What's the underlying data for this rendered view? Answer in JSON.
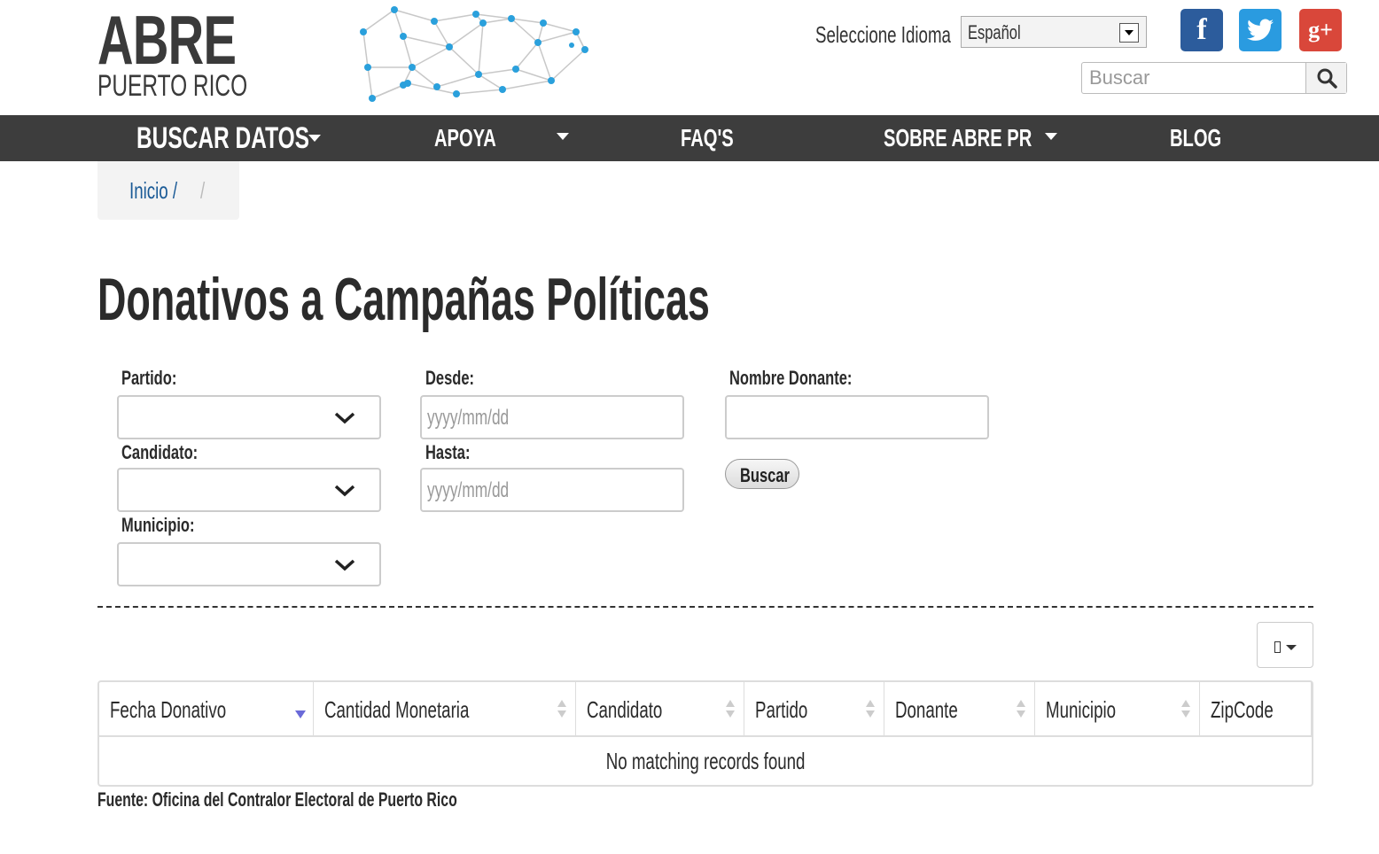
{
  "logo": {
    "line1": "ABRE",
    "line2": "PUERTO RICO",
    "network_color": "#2aa0dc"
  },
  "language": {
    "label": "Seleccione Idioma",
    "selected": "Español"
  },
  "social": {
    "facebook": "f",
    "google_plus": "g+",
    "facebook_color": "#2c5c9c",
    "twitter_color": "#2a9be0",
    "google_color": "#d9473a"
  },
  "search": {
    "placeholder": "Buscar"
  },
  "nav": {
    "items": [
      {
        "label": "BUSCAR DATOS"
      },
      {
        "label": "APOYA"
      },
      {
        "label": "FAQ'S"
      },
      {
        "label": "SOBRE ABRE PR"
      },
      {
        "label": "BLOG"
      }
    ],
    "background": "#3d3d3d"
  },
  "breadcrumb": {
    "home": "Inicio /",
    "separator": "/"
  },
  "page": {
    "title": "Donativos a Campañas Políticas"
  },
  "form": {
    "partido_label": "Partido:",
    "candidato_label": "Candidato:",
    "municipio_label": "Municipio:",
    "desde_label": "Desde:",
    "hasta_label": "Hasta:",
    "date_placeholder": "yyyy/mm/dd",
    "nombre_label": "Nombre Donante:",
    "buscar_button": "Buscar"
  },
  "table": {
    "columns": [
      {
        "label": "Fecha Donativo",
        "sort": "desc"
      },
      {
        "label": "Cantidad Monetaria",
        "sort": "both"
      },
      {
        "label": "Candidato",
        "sort": "both"
      },
      {
        "label": "Partido",
        "sort": "both"
      },
      {
        "label": "Donante",
        "sort": "both"
      },
      {
        "label": "Municipio",
        "sort": "both"
      },
      {
        "label": "ZipCode",
        "sort": "none"
      }
    ],
    "empty_message": "No matching records found"
  },
  "footer": {
    "source": "Fuente: Oficina del Contralor Electoral de Puerto Rico"
  }
}
